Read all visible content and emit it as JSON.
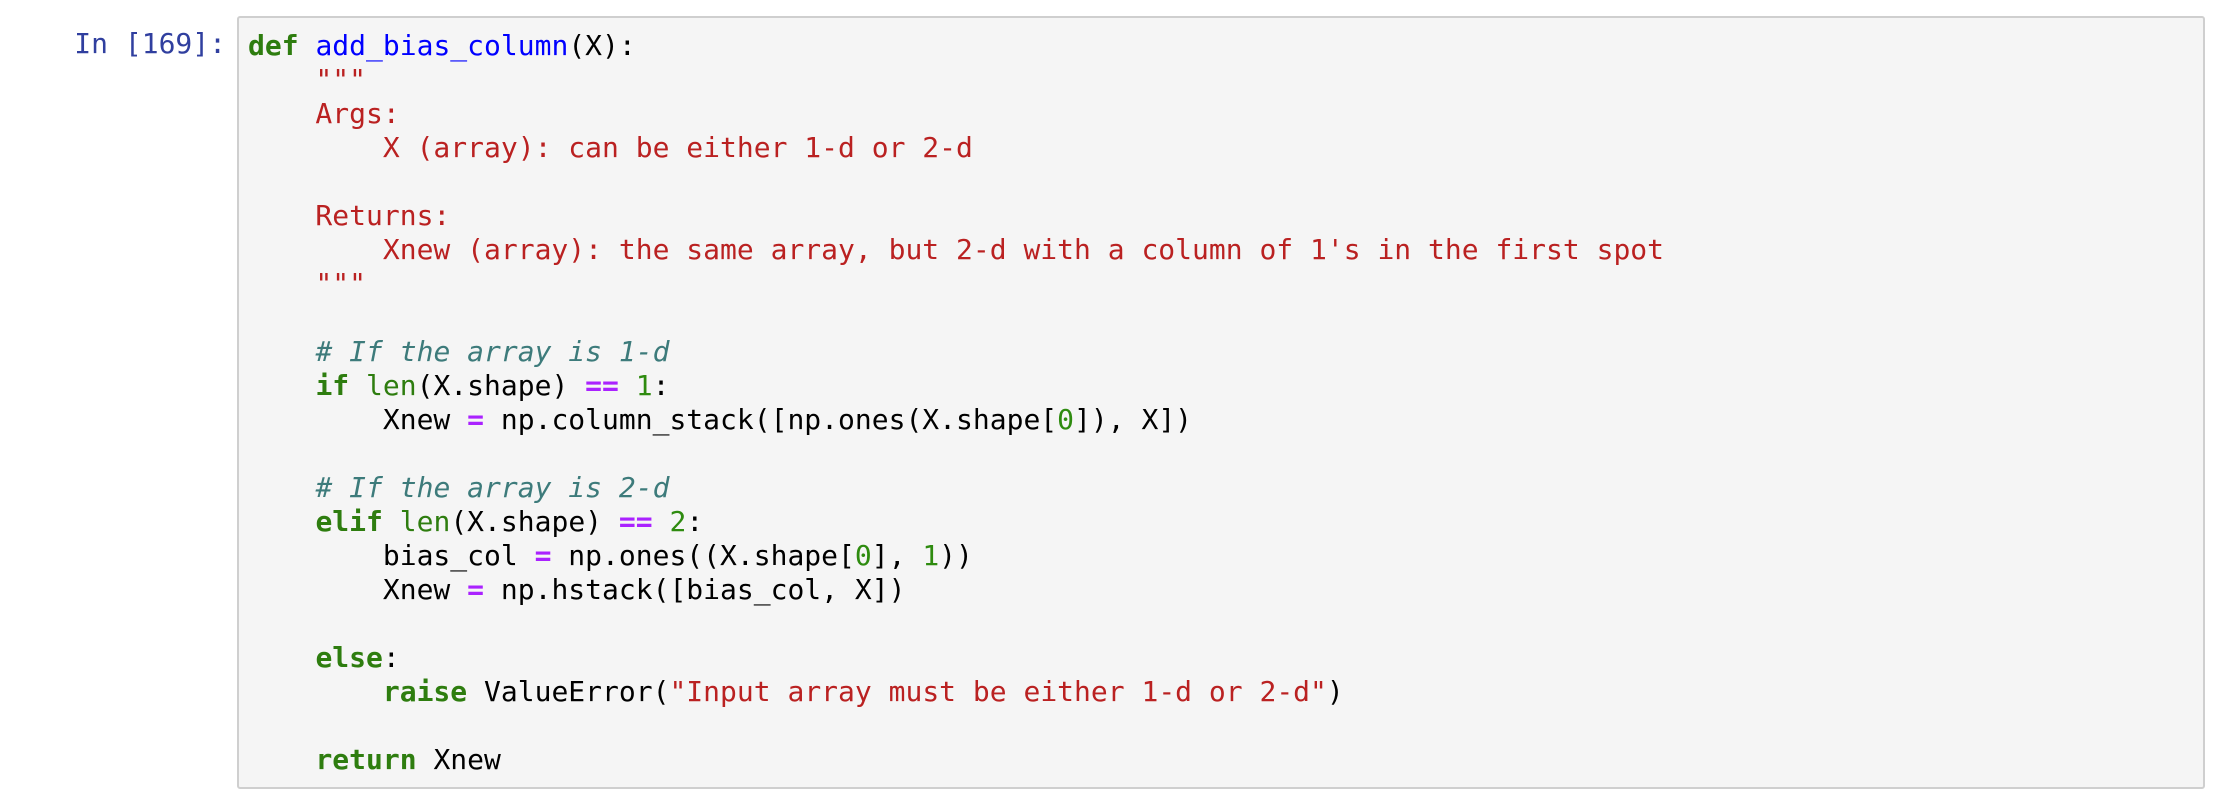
{
  "cell": {
    "prompt": "In [169]:",
    "code_lines": [
      [
        [
          "kw",
          "def"
        ],
        [
          "plain",
          " "
        ],
        [
          "fn",
          "add_bias_column"
        ],
        [
          "plain",
          "(X):"
        ]
      ],
      [
        [
          "str",
          "    \"\"\""
        ]
      ],
      [
        [
          "str",
          "    Args:"
        ]
      ],
      [
        [
          "str",
          "        X (array): can be either 1-d or 2-d"
        ]
      ],
      [
        [
          "str",
          ""
        ]
      ],
      [
        [
          "str",
          "    Returns:"
        ]
      ],
      [
        [
          "str",
          "        Xnew (array): the same array, but 2-d with a column of 1's in the first spot"
        ]
      ],
      [
        [
          "str",
          "    \"\"\""
        ]
      ],
      [
        [
          "plain",
          ""
        ]
      ],
      [
        [
          "plain",
          "    "
        ],
        [
          "com",
          "# If the array is 1-d"
        ]
      ],
      [
        [
          "plain",
          "    "
        ],
        [
          "kw",
          "if"
        ],
        [
          "plain",
          " "
        ],
        [
          "bi",
          "len"
        ],
        [
          "plain",
          "(X.shape) "
        ],
        [
          "op",
          "=="
        ],
        [
          "plain",
          " "
        ],
        [
          "num",
          "1"
        ],
        [
          "plain",
          ":"
        ]
      ],
      [
        [
          "plain",
          "        Xnew "
        ],
        [
          "op",
          "="
        ],
        [
          "plain",
          " np.column_stack([np.ones(X.shape["
        ],
        [
          "num",
          "0"
        ],
        [
          "plain",
          "]), X])"
        ]
      ],
      [
        [
          "plain",
          ""
        ]
      ],
      [
        [
          "plain",
          "    "
        ],
        [
          "com",
          "# If the array is 2-d"
        ]
      ],
      [
        [
          "plain",
          "    "
        ],
        [
          "kw",
          "elif"
        ],
        [
          "plain",
          " "
        ],
        [
          "bi",
          "len"
        ],
        [
          "plain",
          "(X.shape) "
        ],
        [
          "op",
          "=="
        ],
        [
          "plain",
          " "
        ],
        [
          "num",
          "2"
        ],
        [
          "plain",
          ":"
        ]
      ],
      [
        [
          "plain",
          "        bias_col "
        ],
        [
          "op",
          "="
        ],
        [
          "plain",
          " np.ones((X.shape["
        ],
        [
          "num",
          "0"
        ],
        [
          "plain",
          "], "
        ],
        [
          "num",
          "1"
        ],
        [
          "plain",
          "))"
        ]
      ],
      [
        [
          "plain",
          "        Xnew "
        ],
        [
          "op",
          "="
        ],
        [
          "plain",
          " np.hstack([bias_col, X])"
        ]
      ],
      [
        [
          "plain",
          ""
        ]
      ],
      [
        [
          "plain",
          "    "
        ],
        [
          "kw",
          "else"
        ],
        [
          "plain",
          ":"
        ]
      ],
      [
        [
          "plain",
          "        "
        ],
        [
          "kw",
          "raise"
        ],
        [
          "plain",
          " ValueError("
        ],
        [
          "str",
          "\"Input array must be either 1-d or 2-d\""
        ],
        [
          "plain",
          ")"
        ]
      ],
      [
        [
          "plain",
          ""
        ]
      ],
      [
        [
          "plain",
          "    "
        ],
        [
          "kw",
          "return"
        ],
        [
          "plain",
          " Xnew"
        ]
      ]
    ]
  }
}
